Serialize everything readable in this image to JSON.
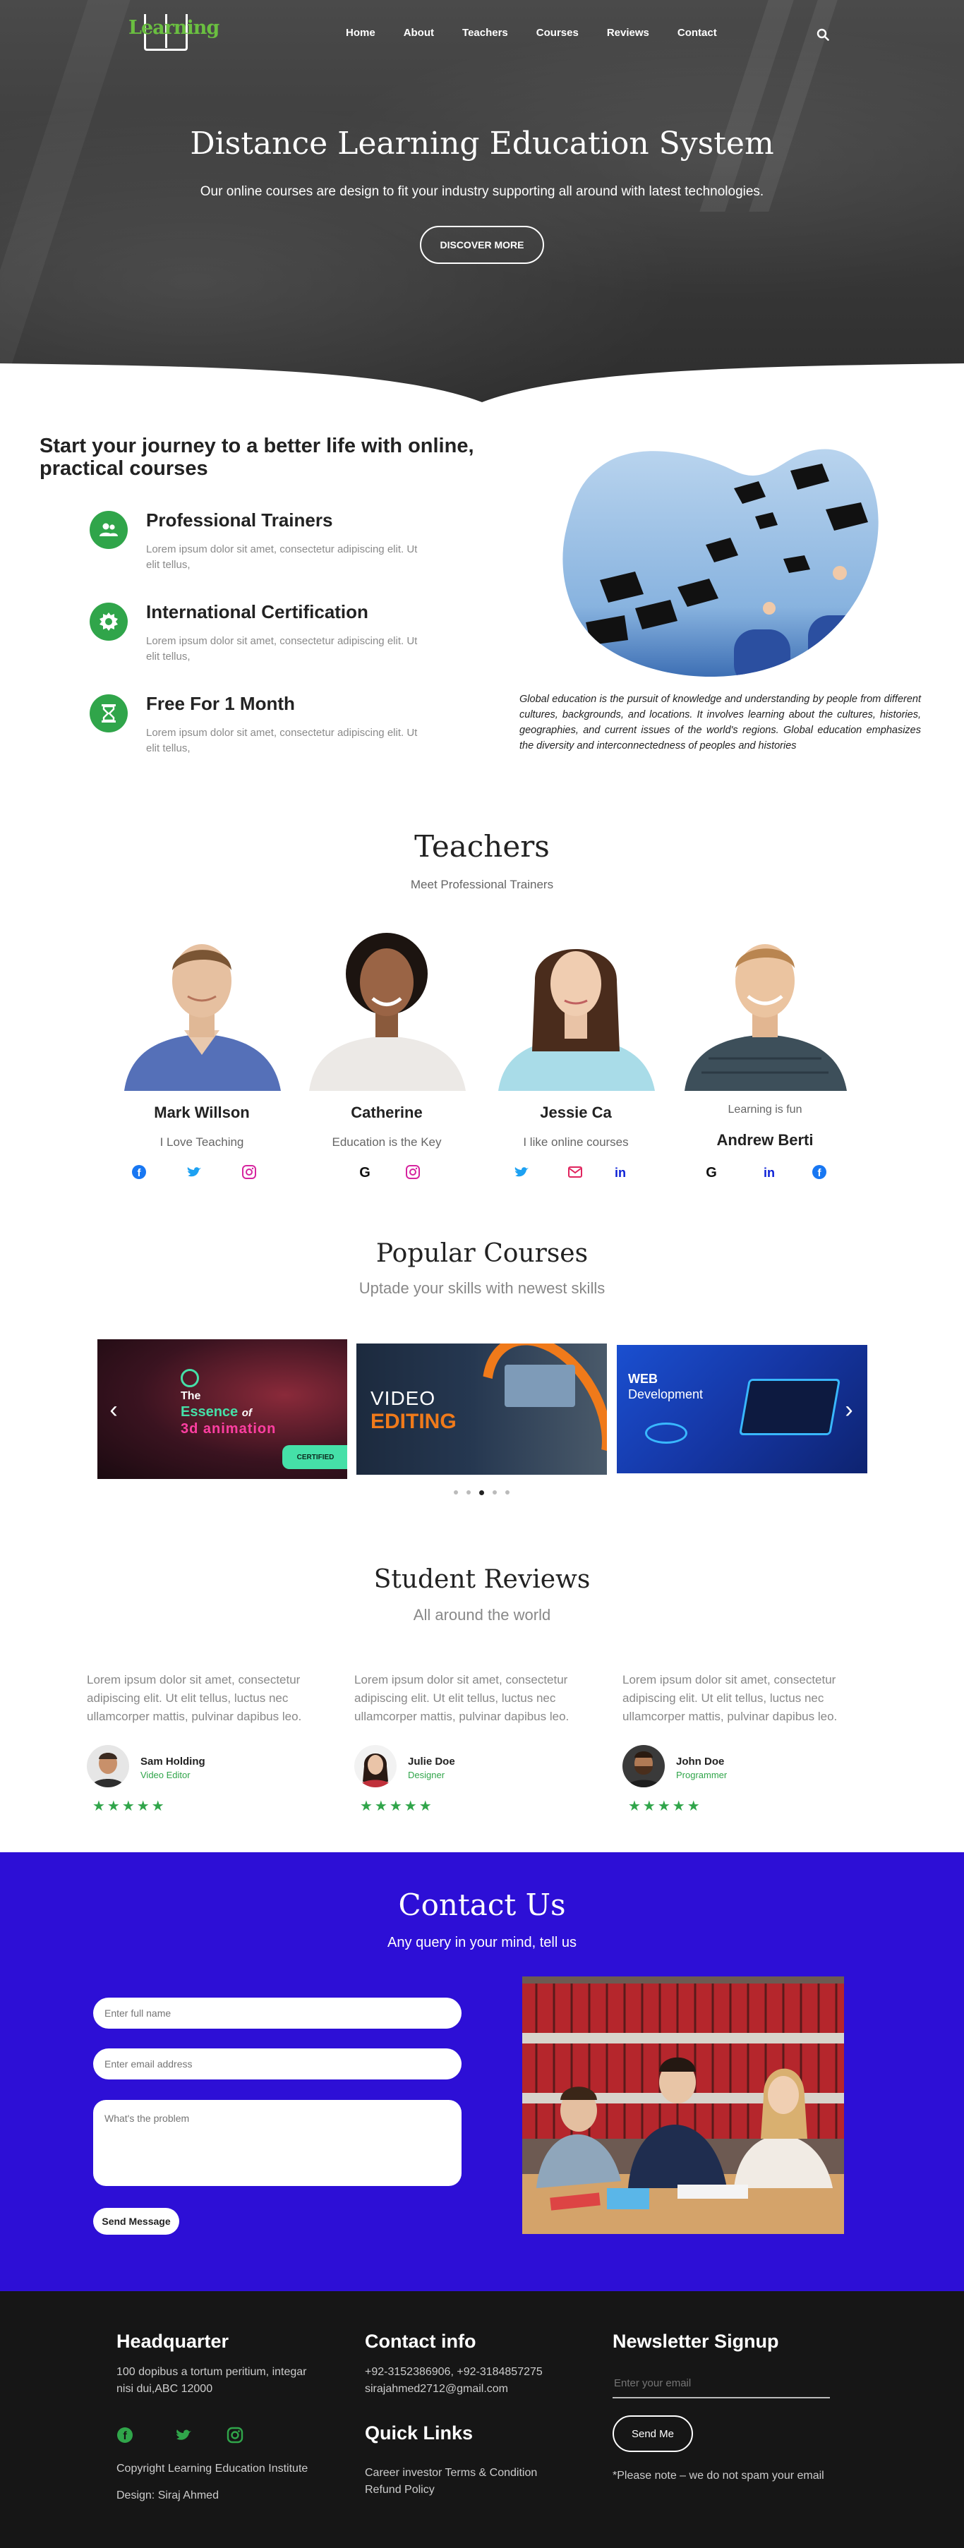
{
  "header": {
    "logo_text": "Learning",
    "nav": [
      "Home",
      "About",
      "Teachers",
      "Courses",
      "Reviews",
      "Contact"
    ],
    "search_icon": "search-icon"
  },
  "hero": {
    "title": "Distance Learning Education System",
    "subtitle": "Our online courses are design to fit your industry supporting all around with latest technologies.",
    "button": "DISCOVER MORE"
  },
  "features": {
    "title": "Start your journey to a better life with online, practical courses",
    "items": [
      {
        "title": "Professional Trainers",
        "text": "Lorem ipsum dolor sit amet, consectetur adipiscing elit. Ut elit tellus,",
        "icon": "users-icon"
      },
      {
        "title": "International Certification",
        "text": "Lorem ipsum dolor sit amet, consectetur adipiscing elit. Ut elit tellus,",
        "icon": "certificate-icon"
      },
      {
        "title": "Free For 1 Month",
        "text": "Lorem ipsum dolor sit amet, consectetur adipiscing elit. Ut elit tellus,",
        "icon": "hourglass-icon"
      }
    ],
    "quote": "Global education is the pursuit of knowledge and understanding by people from different cultures, backgrounds, and locations. It involves learning about the cultures, histories, geographies, and current issues of the world's regions. Global education emphasizes the diversity and interconnectedness of peoples and histories"
  },
  "teachers": {
    "title": "Teachers",
    "subtitle": "Meet Professional Trainers",
    "list": [
      {
        "name": "Mark Willson",
        "tagline": "I Love Teaching",
        "icons": [
          "facebook-icon",
          "twitter-icon",
          "instagram-icon"
        ]
      },
      {
        "name": "Catherine",
        "tagline": "Education is the Key",
        "icons": [
          "google-icon",
          "instagram-icon"
        ]
      },
      {
        "name": "Jessie Ca",
        "tagline": "I like online courses",
        "icons": [
          "twitter-icon",
          "email-icon",
          "linkedin-icon"
        ]
      },
      {
        "name": "Andrew Berti",
        "tagline": "Learning is fun",
        "icons": [
          "google-icon",
          "linkedin-icon",
          "facebook-icon"
        ]
      }
    ]
  },
  "courses": {
    "title": "Popular Courses",
    "subtitle": "Uptade your skills with newest skills",
    "slides": [
      {
        "line1": "The",
        "line2": "Essence",
        "line2b": "of",
        "line3": "3d animation",
        "badge": "CERTIFIED"
      },
      {
        "line1": "VIDEO",
        "line2": "EDITING"
      },
      {
        "line1": "WEB",
        "line2": "Development"
      }
    ],
    "dot_count": 5,
    "active_dot": 2
  },
  "reviews": {
    "title": "Student Reviews",
    "subtitle": "All around the world",
    "list": [
      {
        "text": "Lorem ipsum dolor sit amet, consectetur adipiscing elit. Ut elit tellus, luctus nec ullamcorper mattis, pulvinar dapibus leo.",
        "name": "Sam Holding",
        "role": "Video Editor",
        "rating": 5
      },
      {
        "text": "Lorem ipsum dolor sit amet, consectetur adipiscing elit. Ut elit tellus, luctus nec ullamcorper mattis, pulvinar dapibus leo.",
        "name": "Julie Doe",
        "role": "Designer",
        "rating": 5
      },
      {
        "text": "Lorem ipsum dolor sit amet, consectetur adipiscing elit. Ut elit tellus, luctus nec ullamcorper mattis, pulvinar dapibus leo.",
        "name": "John Doe",
        "role": "Programmer",
        "rating": 5
      }
    ],
    "star_char": "★★★★★"
  },
  "contact": {
    "title": "Contact Us",
    "subtitle": "Any query in your mind, tell us",
    "name_placeholder": "Enter full name",
    "email_placeholder": "Enter email address",
    "problem_placeholder": "What's the problem",
    "button": "Send Message"
  },
  "footer": {
    "hq_title": "Headquarter",
    "hq_address": "100 dopibus a tortum peritium, integar nisi dui,ABC 12000",
    "copyright": "Copyright Learning Education Institute",
    "design": "Design: Siraj Ahmed",
    "contact_title": "Contact info",
    "phones": "+92-3152386906, +92-3184857275",
    "email": "sirajahmed2712@gmail.com",
    "links_title": "Quick Links",
    "link1": "Career investor Terms & Condition",
    "link2": "Refund Policy",
    "newsletter_title": "Newsletter Signup",
    "newsletter_placeholder": "Enter your email",
    "newsletter_button": "Send Me",
    "note": "*Please note – we do not spam your email"
  },
  "colors": {
    "accent_green": "#30a54a",
    "contact_blue": "#2d0fd6",
    "footer_bg": "#161616"
  }
}
